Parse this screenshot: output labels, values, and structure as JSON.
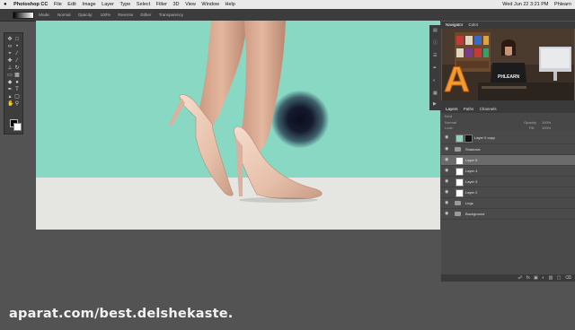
{
  "menubar": {
    "apple": "",
    "items": [
      "Photoshop CC",
      "File",
      "Edit",
      "Image",
      "Layer",
      "Type",
      "Select",
      "Filter",
      "3D",
      "View",
      "Window",
      "Help"
    ],
    "clock": "Wed Jun 22 3:21 PM",
    "user": "Phlearn",
    "app_title": "Photoshop 2015 Tutorial"
  },
  "options": {
    "mode_label": "Mode:",
    "mode_value": "Normal",
    "opacity_label": "Opacity:",
    "opacity_value": "100%",
    "reverse_label": "Reverse",
    "dither_label": "Dither",
    "transparency_label": "Transparency"
  },
  "navigator": {
    "tabs": [
      "Navigator",
      "Color"
    ]
  },
  "layers_panel": {
    "tabs": [
      "Layers",
      "Paths",
      "Channels"
    ],
    "kind_label": "Kind",
    "blend_mode": "Normal",
    "opacity_label": "Opacity:",
    "opacity_value": "100%",
    "lock_label": "Lock:",
    "fill_label": "Fill:",
    "fill_value": "100%",
    "layers": [
      {
        "name": "Layer 0 copy",
        "type": "masked"
      },
      {
        "name": "Shadows",
        "type": "group"
      },
      {
        "name": "Layer 5",
        "type": "layer"
      },
      {
        "name": "Layer 4",
        "type": "layer"
      },
      {
        "name": "Layer 3",
        "type": "layer"
      },
      {
        "name": "Layer 2",
        "type": "layer"
      },
      {
        "name": "Legs",
        "type": "group"
      },
      {
        "name": "Background",
        "type": "group"
      }
    ]
  },
  "colors": {
    "canvas_bg": "#88d8c4",
    "floor": "#e5e6e1",
    "shadow": "#0c0e1c",
    "ui_dark": "#3c3c3c",
    "ui_mid": "#535353"
  },
  "watermark": "aparat.com/best.delshekaste."
}
